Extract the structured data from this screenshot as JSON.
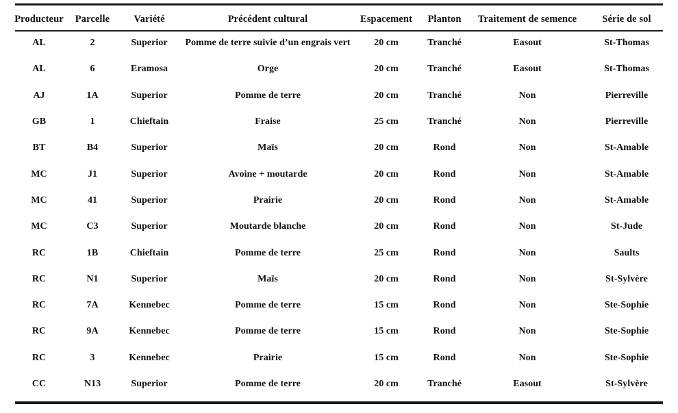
{
  "table": {
    "columns": [
      {
        "key": "producteur",
        "label": "Producteur"
      },
      {
        "key": "parcelle",
        "label": "Parcelle"
      },
      {
        "key": "variete",
        "label": "Variété"
      },
      {
        "key": "precedent",
        "label": "Précédent cultural"
      },
      {
        "key": "espacement",
        "label": "Espacement"
      },
      {
        "key": "planton",
        "label": "Planton"
      },
      {
        "key": "traitement",
        "label": "Traitement de semence"
      },
      {
        "key": "serie",
        "label": "Série de sol"
      }
    ],
    "rows": [
      {
        "producteur": "AL",
        "parcelle": "2",
        "variete": "Superior",
        "precedent": "Pomme de terre suivie d’un engrais vert",
        "espacement": "20 cm",
        "planton": "Tranché",
        "traitement": "Easout",
        "serie": "St-Thomas"
      },
      {
        "producteur": "AL",
        "parcelle": "6",
        "variete": "Eramosa",
        "precedent": "Orge",
        "espacement": "20 cm",
        "planton": "Tranché",
        "traitement": "Easout",
        "serie": "St-Thomas"
      },
      {
        "producteur": "AJ",
        "parcelle": "1A",
        "variete": "Superior",
        "precedent": "Pomme de terre",
        "espacement": "20 cm",
        "planton": "Tranché",
        "traitement": "Non",
        "serie": "Pierreville"
      },
      {
        "producteur": "GB",
        "parcelle": "1",
        "variete": "Chieftain",
        "precedent": "Fraise",
        "espacement": "25 cm",
        "planton": "Tranché",
        "traitement": "Non",
        "serie": "Pierreville"
      },
      {
        "producteur": "BT",
        "parcelle": "B4",
        "variete": "Superior",
        "precedent": "Maïs",
        "espacement": "20 cm",
        "planton": "Rond",
        "traitement": "Non",
        "serie": "St-Amable"
      },
      {
        "producteur": "MC",
        "parcelle": "J1",
        "variete": "Superior",
        "precedent": "Avoine + moutarde",
        "espacement": "20 cm",
        "planton": "Rond",
        "traitement": "Non",
        "serie": "St-Amable"
      },
      {
        "producteur": "MC",
        "parcelle": "41",
        "variete": "Superior",
        "precedent": "Prairie",
        "espacement": "20 cm",
        "planton": "Rond",
        "traitement": "Non",
        "serie": "St-Amable"
      },
      {
        "producteur": "MC",
        "parcelle": "C3",
        "variete": "Superior",
        "precedent": "Moutarde blanche",
        "espacement": "20 cm",
        "planton": "Rond",
        "traitement": "Non",
        "serie": "St-Jude"
      },
      {
        "producteur": "RC",
        "parcelle": "1B",
        "variete": "Chieftain",
        "precedent": "Pomme de terre",
        "espacement": "25 cm",
        "planton": "Rond",
        "traitement": "Non",
        "serie": "Saults"
      },
      {
        "producteur": "RC",
        "parcelle": "N1",
        "variete": "Superior",
        "precedent": "Maïs",
        "espacement": "20 cm",
        "planton": "Rond",
        "traitement": "Non",
        "serie": "St-Sylvère"
      },
      {
        "producteur": "RC",
        "parcelle": "7A",
        "variete": "Kennebec",
        "precedent": "Pomme de terre",
        "espacement": "15 cm",
        "planton": "Rond",
        "traitement": "Non",
        "serie": "Ste-Sophie"
      },
      {
        "producteur": "RC",
        "parcelle": "9A",
        "variete": "Kennebec",
        "precedent": "Pomme de terre",
        "espacement": "15 cm",
        "planton": "Rond",
        "traitement": "Non",
        "serie": "Ste-Sophie"
      },
      {
        "producteur": "RC",
        "parcelle": "3",
        "variete": "Kennebec",
        "precedent": "Prairie",
        "espacement": "15 cm",
        "planton": "Rond",
        "traitement": "Non",
        "serie": "Ste-Sophie"
      },
      {
        "producteur": "CC",
        "parcelle": "N13",
        "variete": "Superior",
        "precedent": "Pomme de terre",
        "espacement": "20 cm",
        "planton": "Tranché",
        "traitement": "Easout",
        "serie": "St-Sylvère"
      }
    ]
  }
}
